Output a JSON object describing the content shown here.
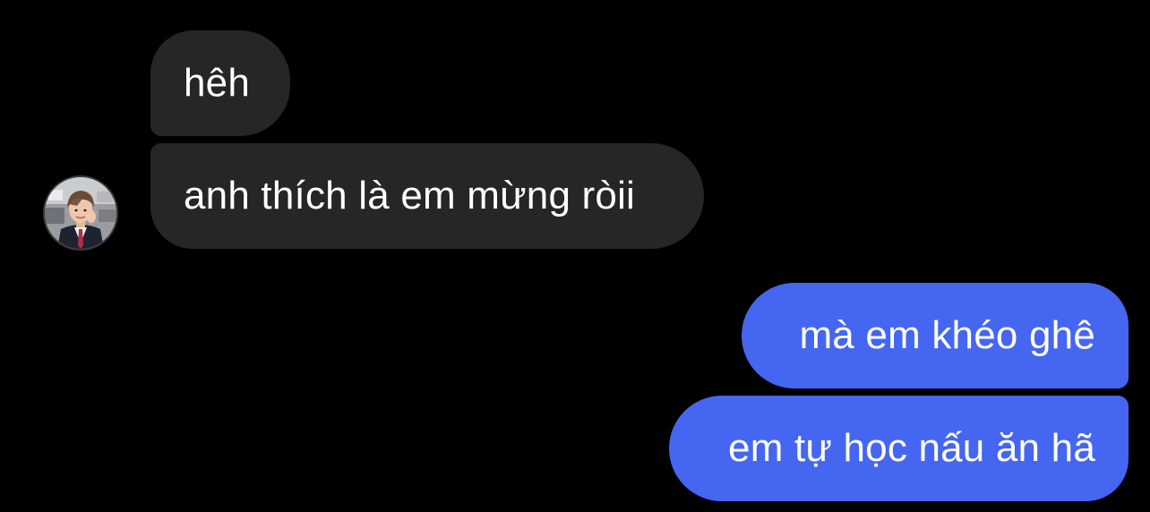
{
  "conversation": {
    "incoming": [
      {
        "text": "hêh"
      },
      {
        "text": "anh thích là em mừng ròii"
      }
    ],
    "outgoing": [
      {
        "text": "mà em khéo ghê"
      },
      {
        "text": "em tự học nấu ăn hã"
      }
    ],
    "avatar_icon": "profile-photo",
    "colors": {
      "background": "#000000",
      "incoming_bubble": "#262626",
      "outgoing_bubble": "#4566F0",
      "text": "#FFFFFF"
    }
  }
}
